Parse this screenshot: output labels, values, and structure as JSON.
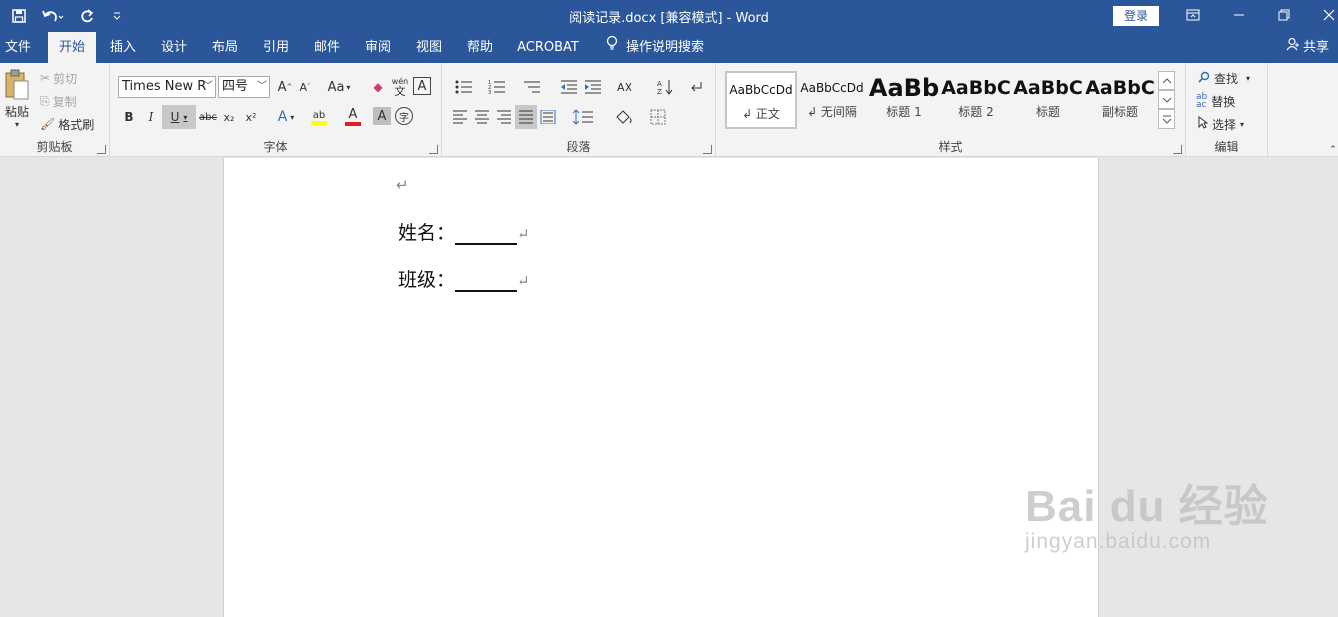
{
  "window": {
    "title": "阅读记录.docx [兼容模式] - Word",
    "login_label": "登录",
    "share_label": "共享"
  },
  "qat": {
    "save_icon": "save-icon",
    "undo_icon": "undo-icon",
    "redo_icon": "redo-icon",
    "customize_icon": "customize-qat-icon"
  },
  "tabs": [
    {
      "label": "文件"
    },
    {
      "label": "开始"
    },
    {
      "label": "插入"
    },
    {
      "label": "设计"
    },
    {
      "label": "布局"
    },
    {
      "label": "引用"
    },
    {
      "label": "邮件"
    },
    {
      "label": "审阅"
    },
    {
      "label": "视图"
    },
    {
      "label": "帮助"
    },
    {
      "label": "ACROBAT"
    }
  ],
  "tell_me": "操作说明搜索",
  "ribbon": {
    "clipboard": {
      "label": "剪贴板",
      "paste": "粘贴",
      "cut": "剪切",
      "copy": "复制",
      "format_painter": "格式刷"
    },
    "font": {
      "label": "字体",
      "font_name": "Times New R",
      "font_size": "四号",
      "change_case": "Aa",
      "bold": "B",
      "italic": "I",
      "underline": "U",
      "strike": "abc",
      "subscript": "x₂",
      "superscript": "x²",
      "phonetic": "wén",
      "phonetic_char": "文",
      "border_char": "A",
      "shade_char": "A",
      "circle_char": "字"
    },
    "paragraph": {
      "label": "段落"
    },
    "styles": {
      "label": "样式",
      "items": [
        {
          "sample": "AaBbCcDd",
          "name": "↲ 正文"
        },
        {
          "sample": "AaBbCcDd",
          "name": "↲ 无间隔"
        },
        {
          "sample": "AaBb",
          "name": "标题 1"
        },
        {
          "sample": "AaBbC",
          "name": "标题 2"
        },
        {
          "sample": "AaBbC",
          "name": "标题"
        },
        {
          "sample": "AaBbC",
          "name": "副标题"
        }
      ]
    },
    "editing": {
      "label": "编辑",
      "find": "查找",
      "replace": "替换",
      "select": "选择"
    }
  },
  "document": {
    "paragraph_mark": "↵",
    "lines": [
      {
        "label": "姓名："
      },
      {
        "label": "班级："
      }
    ]
  },
  "watermark": {
    "big": "Bai du 经验",
    "small": "jingyan.baidu.com"
  }
}
